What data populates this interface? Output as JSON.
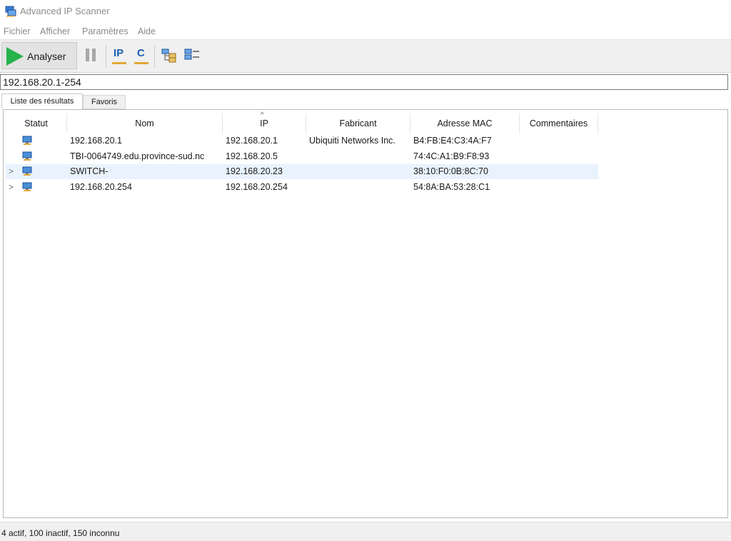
{
  "window": {
    "title": "Advanced IP Scanner"
  },
  "menu": {
    "items": [
      "Fichier",
      "Afficher",
      "Paramètres",
      "Aide"
    ]
  },
  "toolbar": {
    "scan_label": "Analyser",
    "ip_label": "IP",
    "c_label": "C"
  },
  "range_input": {
    "value": "192.168.20.1-254"
  },
  "tabs": [
    "Liste des résultats",
    "Favoris"
  ],
  "columns": [
    "Statut",
    "Nom",
    "IP",
    "Fabricant",
    "Adresse MAC",
    "Commentaires"
  ],
  "rows": [
    {
      "name": "192.168.20.1",
      "ip": "192.168.20.1",
      "maker": "Ubiquiti Networks Inc.",
      "mac": "B4:FB:E4:C3:4A:F7",
      "comment": ""
    },
    {
      "name": "TBI-0064749.edu.province-sud.nc",
      "ip": "192.168.20.5",
      "maker": "",
      "mac": "74:4C:A1:B9:F8:93",
      "comment": ""
    },
    {
      "name": "SWITCH-",
      "ip": "192.168.20.23",
      "maker": "",
      "mac": "38:10:F0:0B:8C:70",
      "comment": ""
    },
    {
      "name": "192.168.20.254",
      "ip": "192.168.20.254",
      "maker": "",
      "mac": "54:8A:BA:53:28:C1",
      "comment": ""
    }
  ],
  "status_bar": {
    "text": "4 actif, 100 inactif, 150 inconnu"
  },
  "colors": {
    "accent_green": "#27b24a",
    "selected_row": "#e8f3fd",
    "icon_blue": "#1a5fb4"
  }
}
